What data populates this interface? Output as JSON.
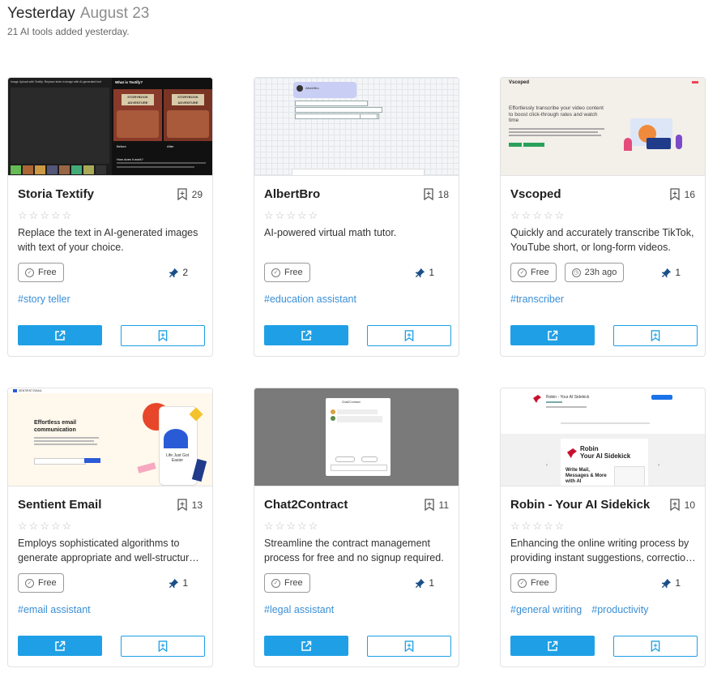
{
  "header": {
    "day": "Yesterday",
    "date": "August 23",
    "subtitle": "21 AI tools added yesterday."
  },
  "colors": {
    "accent": "#1fa0e6",
    "tag": "#3a8fd6",
    "star": "#bdbdbd"
  },
  "cards": [
    {
      "title": "Storia Textify",
      "saves": "29",
      "description": "Replace the text in AI-generated images with text of your choice.",
      "pricing": "Free",
      "age": "",
      "pins": "2",
      "tags": [
        "#story teller"
      ],
      "thumb": {
        "theme": "dark",
        "left_header": "Image Upload with Textify: Replace texts in image with AI-generated text",
        "right_header": "What is Textify?",
        "sign_text": "STORYBOOK ADVENTURE",
        "before_label": "Before",
        "after_label": "After",
        "how_label": "How does it work?"
      }
    },
    {
      "title": "AlbertBro",
      "saves": "18",
      "description": "AI-powered virtual math tutor.",
      "pricing": "Free",
      "age": "",
      "pins": "1",
      "tags": [
        "#education assistant"
      ],
      "thumb": {
        "theme": "grid",
        "bot_name": "AlbertBro"
      }
    },
    {
      "title": "Vscoped",
      "saves": "16",
      "description": "Quickly and accurately transcribe TikTok, YouTube short, or long-form videos.",
      "pricing": "Free",
      "age": "23h ago",
      "pins": "1",
      "tags": [
        "#transcriber"
      ],
      "thumb": {
        "theme": "landing",
        "brand": "Vscoped",
        "headline": "Effortlessly transcribe your video content to boost click-through rates and watch time"
      }
    },
    {
      "title": "Sentient Email",
      "saves": "13",
      "description": "Employs sophisticated algorithms to generate appropriate and well-structured emails.",
      "pricing": "Free",
      "age": "",
      "pins": "1",
      "tags": [
        "#email assistant"
      ],
      "thumb": {
        "theme": "email",
        "brand": "SENTIENT EMAIL",
        "headline": "Effortless email communication",
        "phone_text": "Life Just Got Easier"
      }
    },
    {
      "title": "Chat2Contract",
      "saves": "11",
      "description": "Streamline the contract management process for free and no signup required.",
      "pricing": "Free",
      "age": "",
      "pins": "1",
      "tags": [
        "#legal assistant"
      ],
      "thumb": {
        "theme": "modal",
        "modal_title": "Chat2Contract"
      }
    },
    {
      "title": "Robin - Your AI Sidekick",
      "saves": "10",
      "description": "Enhancing the online writing process by providing instant suggestions, corrections and improvements.",
      "pricing": "Free",
      "age": "",
      "pins": "1",
      "tags": [
        "#general writing",
        "#productivity"
      ],
      "thumb": {
        "theme": "robin",
        "store_title": "Robin - Your AI Sidekick",
        "banner_title": "Robin\nYour AI Sidekick",
        "banner_sub": "Write Mail, Messages & More with AI"
      }
    }
  ]
}
